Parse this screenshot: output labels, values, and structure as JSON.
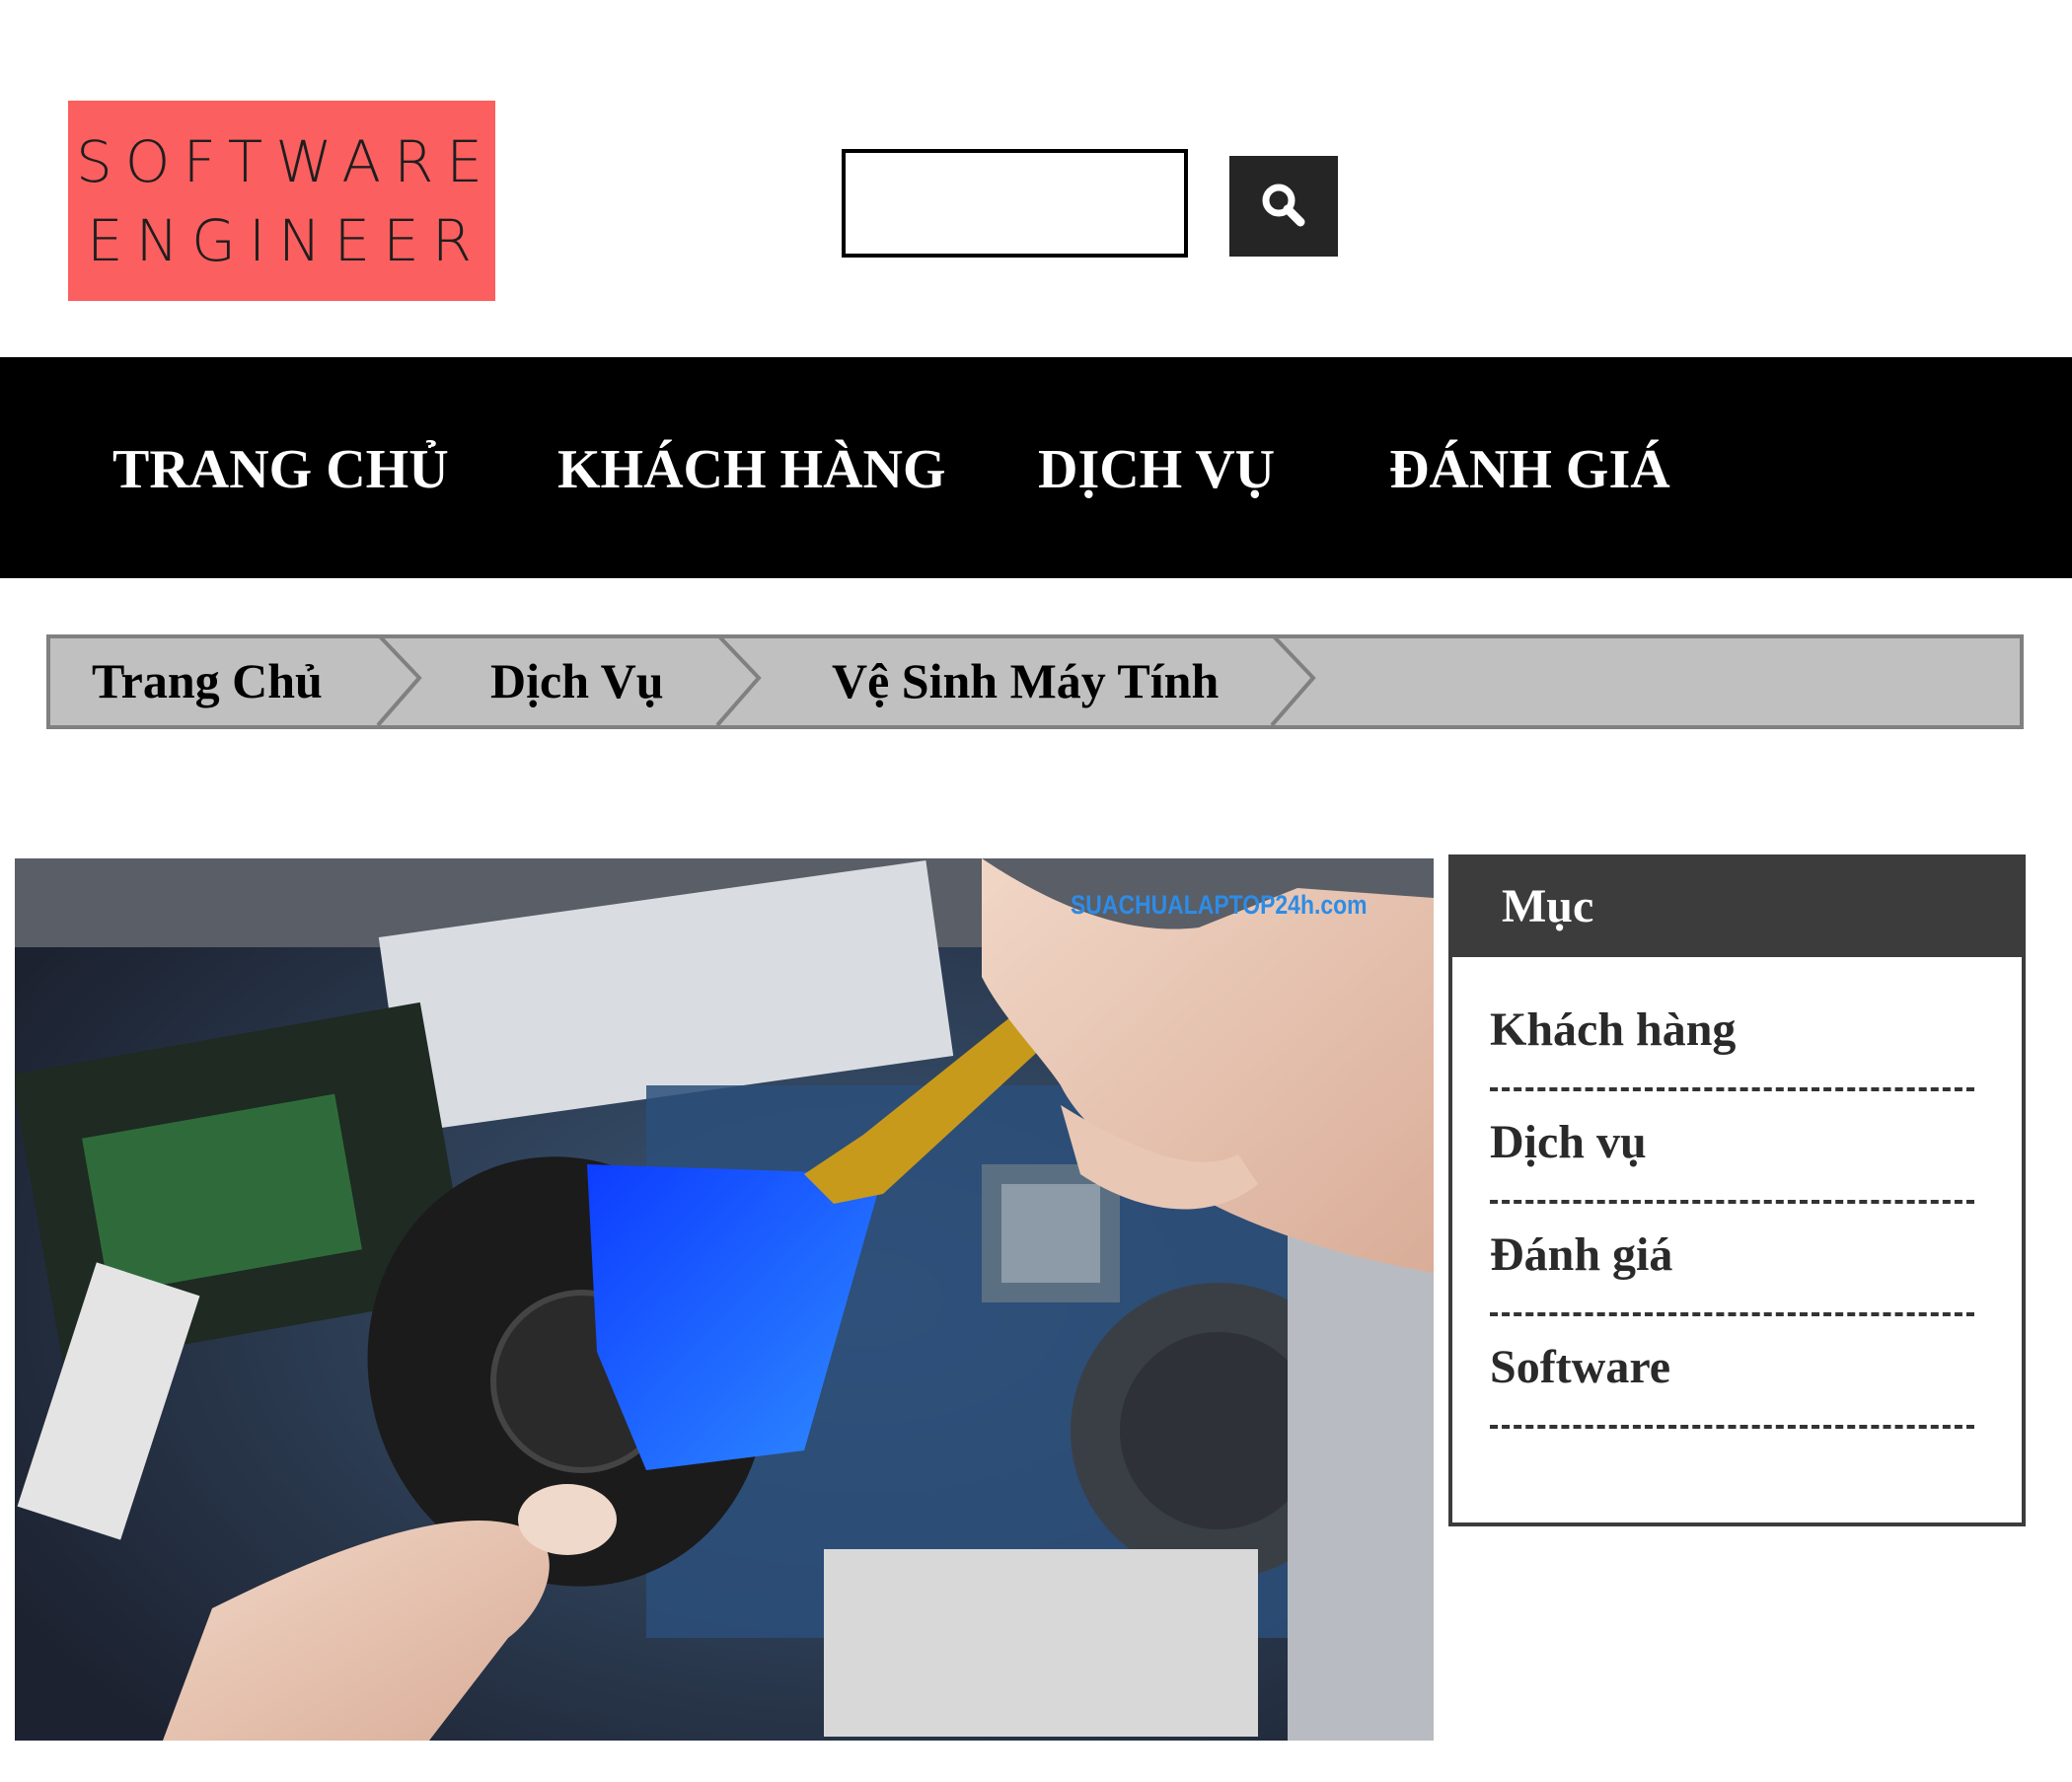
{
  "logo": {
    "line1": "SOFTWARE",
    "line2": "ENGINEER",
    "background": "#fb5f5f"
  },
  "search": {
    "value": "",
    "placeholder": "",
    "button_icon": "search-icon"
  },
  "nav": {
    "items": [
      {
        "label": "TRANG CHỦ"
      },
      {
        "label": "KHÁCH HÀNG"
      },
      {
        "label": "DỊCH VỤ"
      },
      {
        "label": "ĐÁNH GIÁ"
      }
    ]
  },
  "breadcrumb": {
    "items": [
      {
        "label": "Trang Chủ"
      },
      {
        "label": "Dịch Vụ"
      },
      {
        "label": "Vệ Sinh Máy Tính"
      }
    ]
  },
  "hero": {
    "watermark": "SUACHUALAPTOP24h.com"
  },
  "sidebar": {
    "title": "Mục",
    "items": [
      {
        "label": "Khách hàng"
      },
      {
        "label": "Dịch vụ"
      },
      {
        "label": "Đánh giá"
      },
      {
        "label": "Software"
      }
    ]
  }
}
